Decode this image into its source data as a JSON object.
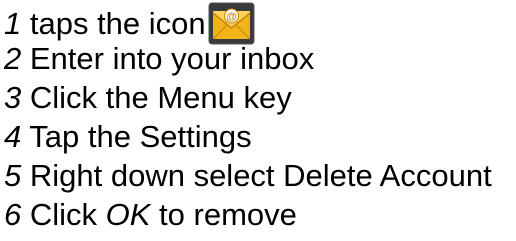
{
  "steps": [
    {
      "num": "1",
      "text_before": " taps the icon",
      "icon": "email-app-icon"
    },
    {
      "num": "2",
      "text": " Enter into your inbox"
    },
    {
      "num": "3",
      "text": " Click the Menu key"
    },
    {
      "num": "4",
      "text": " Tap the Settings"
    },
    {
      "num": "5",
      "text": " Right down select Delete Account"
    },
    {
      "num": "6",
      "text_before": " Click ",
      "emphasis": "OK",
      "text_after": " to remove"
    }
  ],
  "colors": {
    "text": "#000000",
    "icon_envelope": "#f2b21a",
    "icon_envelope_dark": "#c88608",
    "icon_border": "#555555"
  }
}
